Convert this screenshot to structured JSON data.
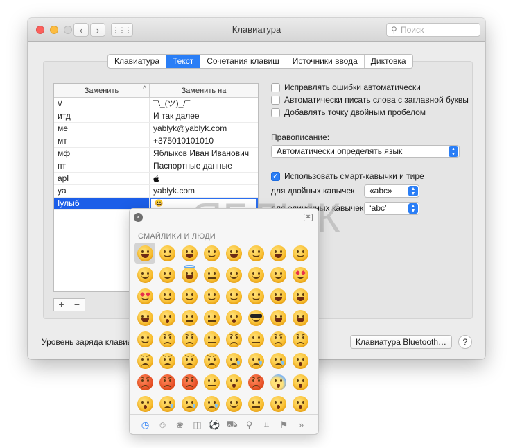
{
  "window": {
    "title": "Клавиатура",
    "search_placeholder": "Поиск",
    "back_glyph": "‹",
    "forward_glyph": "›",
    "grid_glyph": "⋮⋮⋮",
    "traffic_lights": [
      "#fc605c",
      "#fdbc40",
      "#d5d5d5"
    ]
  },
  "tabs": [
    {
      "label": "Клавиатура",
      "active": false
    },
    {
      "label": "Текст",
      "active": true
    },
    {
      "label": "Сочетания клавиш",
      "active": false
    },
    {
      "label": "Источники ввода",
      "active": false
    },
    {
      "label": "Диктовка",
      "active": false
    }
  ],
  "table": {
    "headers": [
      "Заменить",
      "Заменить на"
    ],
    "sort_glyph": "^",
    "rows": [
      {
        "replace": "\\/",
        "with": "¯\\_(ツ)_/¯"
      },
      {
        "replace": "итд",
        "with": "И так далее"
      },
      {
        "replace": "ме",
        "with": "yablyk@yablyk.com"
      },
      {
        "replace": "мт",
        "with": "+375010101010"
      },
      {
        "replace": "мф",
        "with": "Яблыков Иван Иванович"
      },
      {
        "replace": "пт",
        "with": "Паспортные данные"
      },
      {
        "replace": "apl",
        "with": ""
      },
      {
        "replace": "ya",
        "with": "yablyk.com"
      },
      {
        "replace": "Iулыб",
        "with": "😀"
      }
    ],
    "add_label": "+",
    "remove_label": "−"
  },
  "options": {
    "autocorrect": {
      "label": "Исправлять ошибки автоматически",
      "checked": false
    },
    "autocapitalize": {
      "label": "Автоматически писать слова с заглавной буквы",
      "checked": false
    },
    "double_space": {
      "label": "Добавлять точку двойным пробелом",
      "checked": false
    },
    "spelling_label": "Правописание:",
    "spelling_value": "Автоматически определять язык",
    "smart_quotes": {
      "label": "Использовать смарт-кавычки и тире",
      "checked": true
    },
    "double_quotes_label": "для двойных кавычек",
    "double_quotes_value": "«abc»",
    "single_quotes_label": "для одиночных кавычек",
    "single_quotes_value": "‘abc’"
  },
  "footer": {
    "battery_label": "Уровень заряда клавиат",
    "bluetooth_button": "Клавиатура Bluetooth…",
    "help": "?"
  },
  "watermark": "ЯБЛЫК",
  "emoji_picker": {
    "category_title": "СМАЙЛИКИ И ЛЮДИ",
    "close_glyph": "×",
    "expand_glyph": "⌘",
    "selected_index": 0,
    "category_icons": [
      {
        "name": "recent-icon",
        "glyph": "◷"
      },
      {
        "name": "smiley-icon",
        "glyph": "☺"
      },
      {
        "name": "animal-icon",
        "glyph": "❀"
      },
      {
        "name": "food-icon",
        "glyph": "◫"
      },
      {
        "name": "ball-icon",
        "glyph": "⚽"
      },
      {
        "name": "travel-icon",
        "glyph": "⛟"
      },
      {
        "name": "objects-icon",
        "glyph": "⚲"
      },
      {
        "name": "symbols-icon",
        "glyph": "⌗"
      },
      {
        "name": "flag-icon",
        "glyph": "⚑"
      },
      {
        "name": "more-icon",
        "glyph": "»"
      }
    ]
  }
}
